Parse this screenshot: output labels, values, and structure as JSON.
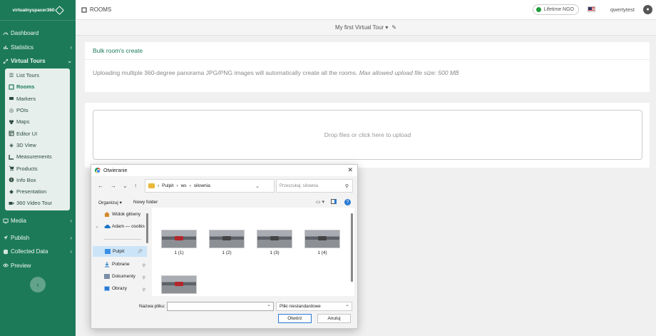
{
  "brand": {
    "name": "virtualnyspacer360"
  },
  "sidebar": {
    "items": [
      {
        "label": "Dashboard",
        "icon": "dashboard-icon"
      },
      {
        "label": "Statistics",
        "icon": "chart-icon",
        "chevron": "›"
      },
      {
        "label": "Virtual Tours",
        "icon": "route-icon",
        "chevron": "⌄"
      }
    ],
    "sub_items": [
      {
        "label": "List Tours",
        "icon": "list-icon"
      },
      {
        "label": "Rooms",
        "icon": "rooms-icon"
      },
      {
        "label": "Markers",
        "icon": "marker-icon"
      },
      {
        "label": "POIs",
        "icon": "target-icon"
      },
      {
        "label": "Maps",
        "icon": "map-icon"
      },
      {
        "label": "Editor UI",
        "icon": "editor-icon"
      },
      {
        "label": "3D View",
        "icon": "cube-icon"
      },
      {
        "label": "Measurements",
        "icon": "ruler-icon"
      },
      {
        "label": "Products",
        "icon": "cart-icon"
      },
      {
        "label": "Info Box",
        "icon": "info-icon"
      },
      {
        "label": "Presentation",
        "icon": "presentation-icon"
      },
      {
        "label": "360 Video Tour",
        "icon": "video-icon"
      }
    ],
    "bottom_items": [
      {
        "label": "Media",
        "icon": "monitor-icon",
        "chevron": "›"
      },
      {
        "label": "Publish",
        "icon": "send-icon",
        "chevron": "›"
      },
      {
        "label": "Collected Data",
        "icon": "database-icon",
        "chevron": "›"
      },
      {
        "label": "Preview",
        "icon": "eye-icon"
      }
    ],
    "collapse_symbol": "‹"
  },
  "topbar": {
    "page_title": "ROOMS",
    "plan_badge": "Lifetime NGO",
    "username": "qwertytest"
  },
  "tour_selector": {
    "label": "My first Virtual Tour",
    "caret": "▾",
    "edit_icon": "✎"
  },
  "bulk_card": {
    "title": "Bulk room's create",
    "description": "Uploading multiple 360-degree panorama JPG/PNG images will automatically create all the rooms.",
    "limit_note": "Max allowed upload file size: 500 MB"
  },
  "dropzone": {
    "text": "Drop files or click here to upload"
  },
  "dialog": {
    "title": "Otwieranie",
    "close": "✕",
    "breadcrumb": [
      "Pulpit",
      "ws",
      "silownia"
    ],
    "search_placeholder": "Przeszukaj: silownia",
    "organize": "Organizuj ▾",
    "new_folder": "Nowy folder",
    "nav": [
      {
        "label": "Widok główny",
        "icon": "home-icon"
      },
      {
        "label": "Adam — osobis",
        "icon": "cloud-icon"
      },
      {
        "label": "Pulpit",
        "icon": "desktop-icon",
        "pinned": true,
        "selected": true
      },
      {
        "label": "Pobrane",
        "icon": "download-icon",
        "pinned": true
      },
      {
        "label": "Dokumenty",
        "icon": "documents-icon",
        "pinned": true
      },
      {
        "label": "Obrazy",
        "icon": "pictures-icon",
        "pinned": true
      }
    ],
    "files": [
      "1 (1)",
      "1 (2)",
      "1 (3)",
      "1 (4)",
      ""
    ],
    "filename_label": "Nazwa pliku:",
    "filename_value": "",
    "filetype": "Pliki niestandardowe",
    "open_button": "Otwórz",
    "cancel_button": "Anuluj"
  }
}
